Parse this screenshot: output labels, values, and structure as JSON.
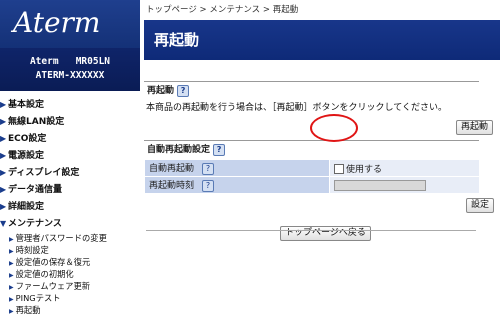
{
  "brand": {
    "logo_text": "Aterm",
    "model": "Aterm   MR05LN",
    "device_name": "ATERM-XXXXXX"
  },
  "sidebar": {
    "items": [
      {
        "label": "基本設定"
      },
      {
        "label": "無線LAN設定"
      },
      {
        "label": "ECO設定"
      },
      {
        "label": "電源設定"
      },
      {
        "label": "ディスプレイ設定"
      },
      {
        "label": "データ通信量"
      },
      {
        "label": "詳細設定"
      },
      {
        "label": "メンテナンス"
      }
    ],
    "sub_items": [
      {
        "label": "管理者パスワードの変更"
      },
      {
        "label": "時刻設定"
      },
      {
        "label": "設定値の保存＆復元"
      },
      {
        "label": "設定値の初期化"
      },
      {
        "label": "ファームウェア更新"
      },
      {
        "label": "PINGテスト"
      },
      {
        "label": "再起動"
      }
    ]
  },
  "breadcrumb": "トップページ > メンテナンス > 再起動",
  "page_title": "再起動",
  "reboot_section": {
    "heading": "再起動",
    "description": "本商品の再起動を行う場合は、［再起動］ボタンをクリックしてください。",
    "button_label": "再起動"
  },
  "auto_reboot_section": {
    "heading": "自動再起動設定",
    "rows": [
      {
        "label": "自動再起動",
        "value": "使用する"
      },
      {
        "label": "再起動時刻",
        "value": ""
      }
    ],
    "apply_label": "設定"
  },
  "back_button_label": "トップページへ戻る",
  "help_icon_glyph": "?",
  "colors": {
    "header_blue": "#143177",
    "highlight_red": "#e01515",
    "label_cell": "#c6d3ec"
  }
}
